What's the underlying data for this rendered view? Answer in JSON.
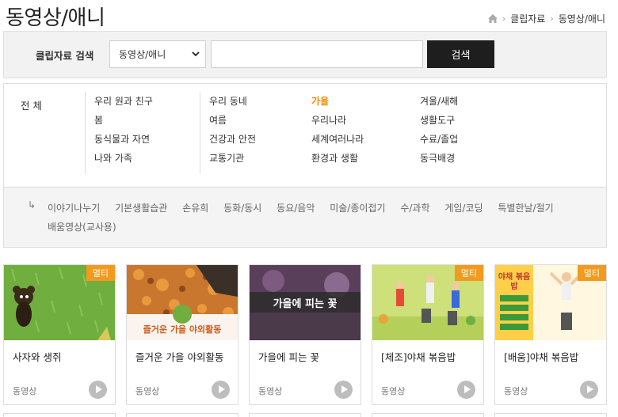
{
  "page": {
    "title": "동영상/애니"
  },
  "breadcrumb": {
    "items": [
      "클립자료",
      "동영상/애니"
    ]
  },
  "search": {
    "label": "클립자료 검색",
    "select_value": "동영상/애니",
    "input_value": "",
    "button_label": "검색"
  },
  "categories": {
    "all_label": "전 체",
    "columns": [
      [
        "우리 원과 친구",
        "봄",
        "동식물과 자연",
        "나와 가족"
      ],
      [
        "우리 동네",
        "여름",
        "건강과 안전",
        "교통기관"
      ],
      [
        "가을",
        "우리나라",
        "세계여러나라",
        "환경과 생활"
      ],
      [
        "겨울/새해",
        "생활도구",
        "수료/졸업",
        "동극배경"
      ]
    ],
    "active": "가을",
    "sub_arrow": "↳",
    "sub_items": [
      "이야기나누기",
      "기본생활습관",
      "손유희",
      "동화/동시",
      "동요/음악",
      "미술/종이접기",
      "수/과학",
      "게임/코딩",
      "특별한날/절기",
      "배움영상(교사용)"
    ]
  },
  "cards": [
    {
      "title": "사자와 생쥐",
      "type": "동영상",
      "badge": "멀티"
    },
    {
      "title": "즐거운 가을 야외활동",
      "type": "동영상",
      "badge": "",
      "thumb_caption": "즐거운 가을 야외활동"
    },
    {
      "title": "가을에 피는 꽃",
      "type": "동영상",
      "badge": "",
      "thumb_caption": "가을에 피는 꽃"
    },
    {
      "title": "[체조]야채 볶음밥",
      "type": "동영상",
      "badge": "멀티"
    },
    {
      "title": "[배움]야채 볶음밥",
      "type": "동영상",
      "badge": "멀티",
      "thumb_caption": "야채 볶음밥"
    }
  ],
  "colors": {
    "accent": "#f08c00",
    "badge": "#f29a1f",
    "button": "#1e1e1e"
  },
  "icons": [
    "home-icon",
    "chevron-right-icon",
    "chevron-down-icon",
    "play-icon"
  ]
}
